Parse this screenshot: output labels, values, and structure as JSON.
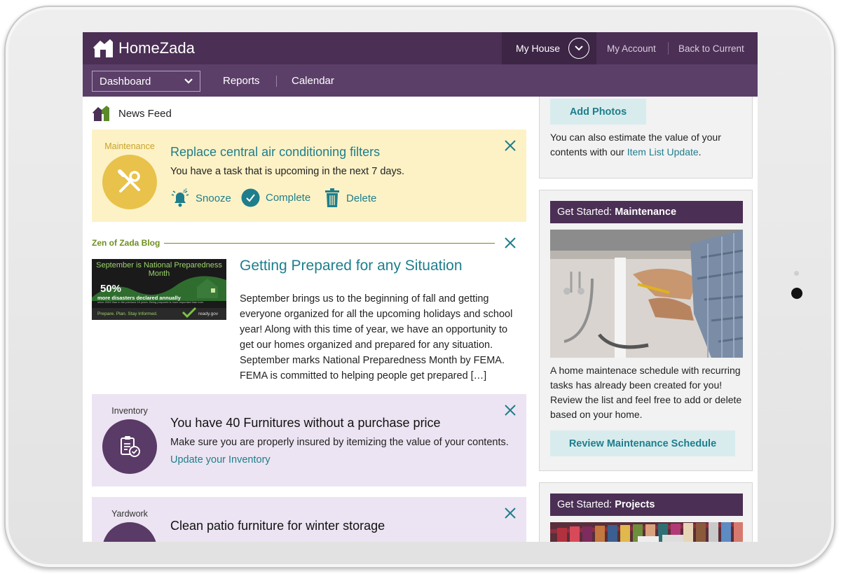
{
  "app": {
    "brand": "HomeZada"
  },
  "topbar": {
    "house_label": "My House",
    "my_account": "My Account",
    "back_to_current": "Back to Current"
  },
  "nav": {
    "dashboard": "Dashboard",
    "reports": "Reports",
    "calendar": "Calendar"
  },
  "feed": {
    "heading": "News Feed",
    "maintenance_card": {
      "category": "Maintenance",
      "title": "Replace central air conditioning filters",
      "text": "You have a task that is upcoming in the next 7 days.",
      "snooze": "Snooze",
      "complete": "Complete",
      "delete": "Delete"
    },
    "blog": {
      "label": "Zen of Zada Blog",
      "title": "Getting Prepared for any Situation",
      "body": "September brings us to the beginning of fall and getting everyone organized for all the upcoming holidays and school year! Along with this time of year, we have an opportunity to get our homes organized and prepared for any situation. September marks National Preparedness Month by FEMA. FEMA is committed to helping people get prepared […]",
      "image": {
        "headline": "September is National Preparedness Month",
        "stat": "50%",
        "stat_text": "more disasters declared annually",
        "stat_small": "since 2003 than in the previous 10 years. Being prepared is more important than ever",
        "footer_left": "Prepare. Plan. Stay Informed.",
        "footer_right": "ready.gov"
      }
    },
    "inventory_card": {
      "category": "Inventory",
      "title": "You have 40 Furnitures without a purchase price",
      "text": "Make sure you are properly insured by itemizing the value of your contents.",
      "link": "Update your Inventory"
    },
    "yardwork_card": {
      "category": "Yardwork",
      "title": "Clean patio furniture for winter storage"
    }
  },
  "sidebar": {
    "photos_panel": {
      "button": "Add Photos",
      "text_before": "You can also estimate the value of your contents with our ",
      "link": "Item List Update",
      "text_after": "."
    },
    "maintenance_panel": {
      "head_prefix": "Get Started: ",
      "head_bold": "Maintenance",
      "text": "A home maintenace schedule with recurring tasks has already been created for you! Review the list and feel free to add or delete based on your home.",
      "button": "Review Maintenance Schedule"
    },
    "projects_panel": {
      "head_prefix": "Get Started: ",
      "head_bold": "Projects"
    }
  },
  "colors": {
    "topbar": "#4b2f55",
    "navbar": "#5b3f69",
    "accent_teal": "#1e7e8c",
    "maintenance_yellow": "#e8c24a",
    "card_yellow_bg": "#fdf2c6",
    "card_purple_bg": "#ece4f2",
    "inventory_purple": "#5a3a66",
    "blog_green": "#6e8f1f"
  }
}
